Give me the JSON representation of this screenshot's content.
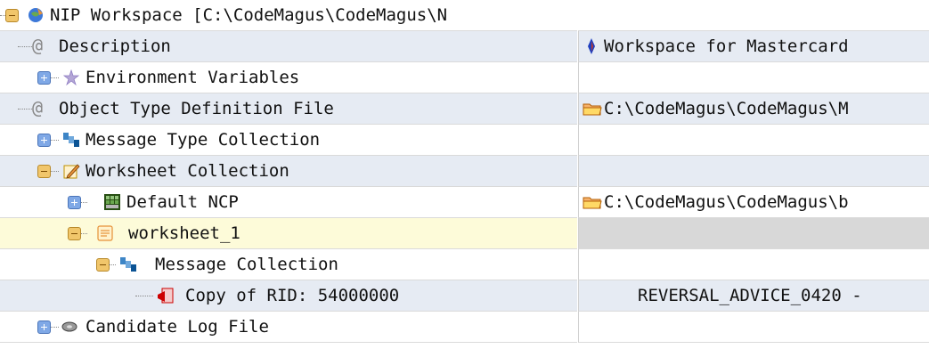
{
  "tree": {
    "rows": [
      {
        "label": "NIP Workspace [C:\\CodeMagus\\CodeMagus\\N",
        "value": ""
      },
      {
        "label": "Description",
        "value": "Workspace for Mastercard"
      },
      {
        "label": "Environment Variables",
        "value": ""
      },
      {
        "label": "Object Type Definition File",
        "value": "C:\\CodeMagus\\CodeMagus\\M"
      },
      {
        "label": "Message Type Collection",
        "value": ""
      },
      {
        "label": "Worksheet Collection",
        "value": ""
      },
      {
        "label": "Default NCP",
        "value": "C:\\CodeMagus\\CodeMagus\\b"
      },
      {
        "label": "worksheet_1",
        "value": ""
      },
      {
        "label": "Message Collection",
        "value": ""
      },
      {
        "label": "Copy of RID: 54000000",
        "value": "REVERSAL_ADVICE_0420 -"
      },
      {
        "label": "Candidate Log File",
        "value": ""
      }
    ]
  },
  "colors": {
    "row_alt": "#e6ebf3",
    "selected_left": "#fdfbd9",
    "selected_right": "#d8d8d8",
    "expand_box": "#f1c66b",
    "collapse_box": "#7fa8e6"
  },
  "icons": [
    "workspace-globe-icon",
    "at-sign-icon",
    "pin-icon",
    "star-icon",
    "folder-icon",
    "message-types-icon",
    "worksheet-pencil-icon",
    "ncp-grid-icon",
    "worksheet-icon",
    "message-collection-icon",
    "message-copy-icon",
    "log-disk-icon"
  ]
}
